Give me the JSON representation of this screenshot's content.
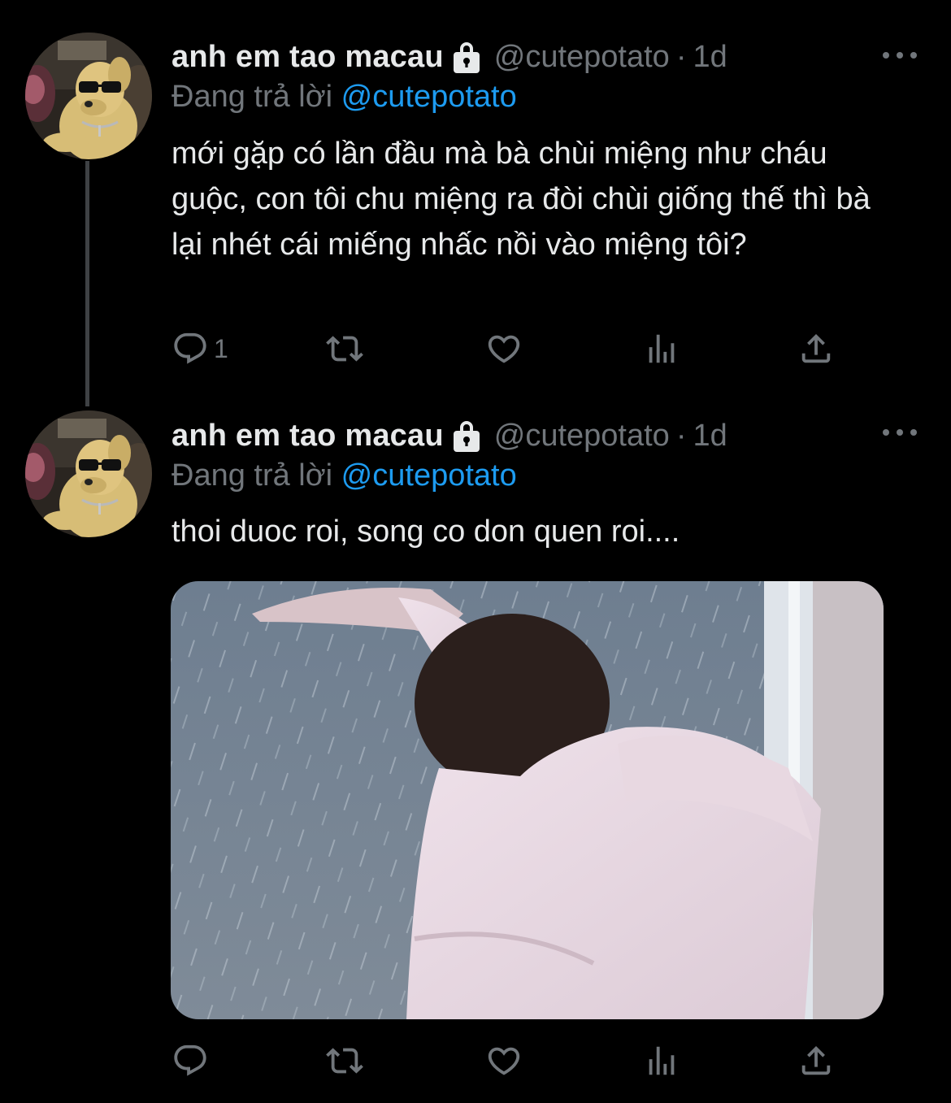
{
  "tweets": [
    {
      "display_name": "anh em tao macau",
      "handle": "@cutepotato",
      "separator": "·",
      "time": "1d",
      "replying_prefix": "Đang trả lời",
      "replying_to": "@cutepotato",
      "text": "mới gặp có lần đầu mà bà chùi miệng như cháu guộc, con tôi chu miệng ra đòi chùi giống thế thì bà lại nhét cái miếng nhấc nồi vào miệng tôi?",
      "reply_count": "1"
    },
    {
      "display_name": "anh em tao macau",
      "handle": "@cutepotato",
      "separator": "·",
      "time": "1d",
      "replying_prefix": "Đang trả lời",
      "replying_to": "@cutepotato",
      "text": "thoi duoc roi, song co don quen roi....",
      "reply_count": ""
    }
  ],
  "icons": {
    "lock": "lock-icon",
    "more": "more-icon",
    "reply": "reply-icon",
    "retweet": "retweet-icon",
    "like": "heart-icon",
    "views": "analytics-icon",
    "share": "share-icon"
  },
  "colors": {
    "background": "#000000",
    "text": "#e7e9ea",
    "secondary": "#71767b",
    "accent": "#1d9bf0"
  }
}
